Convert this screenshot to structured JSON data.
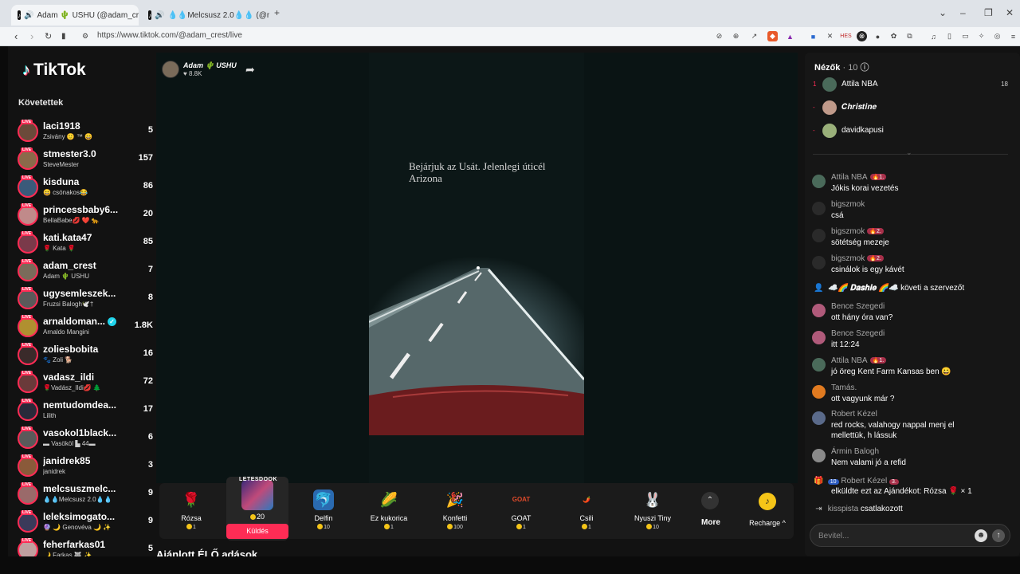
{
  "browser": {
    "tabs": [
      {
        "title": "Adam 🌵 USHU (@adam_crest",
        "active": true
      },
      {
        "title": "💧💧Melcsusz 2.0💧💧 (@melcsu",
        "active": false
      }
    ],
    "new_tab": "+",
    "url": "https://www.tiktok.com/@adam_crest/live"
  },
  "sidebar": {
    "logo": "TikTok",
    "following_title": "Követettek",
    "live_tag": "LIVE",
    "items": [
      {
        "name": "laci1918",
        "sub": "Zsivány 🙂 ™ 😄",
        "count": "5",
        "color": "#6b4a3a"
      },
      {
        "name": "stmester3.0",
        "sub": "SteveMester",
        "count": "157",
        "color": "#8a6a4a"
      },
      {
        "name": "kisduna",
        "sub": "😄 csónakos😂",
        "count": "86",
        "color": "#3a5a7a"
      },
      {
        "name": "princessbaby6...",
        "sub": "BellaBabe💋 ❤️ 🐆",
        "count": "20",
        "color": "#c08a8a"
      },
      {
        "name": "kati.kata47",
        "sub": "🌹 Kata 🌹",
        "count": "85",
        "color": "#7a3a4a"
      },
      {
        "name": "adam_crest",
        "sub": "Adam 🌵 USHU",
        "count": "7",
        "color": "#7a6b5a"
      },
      {
        "name": "ugysemleszek...",
        "sub": "Fruzsi Balogh🕊️†",
        "count": "8",
        "color": "#5a5a5a"
      },
      {
        "name": "arnaldoman...",
        "sub": "Arnaldo Mangini",
        "count": "1.8K",
        "color": "#b09030",
        "verified": true
      },
      {
        "name": "zoliesbobita",
        "sub": "🐾 Zoli 🐕",
        "count": "16",
        "color": "#3a2a2a"
      },
      {
        "name": "vadasz_ildi",
        "sub": "🌹Vadász_Ildi💋 🌲",
        "count": "72",
        "color": "#6a3a3a"
      },
      {
        "name": "nemtudomdea...",
        "sub": "Lilith",
        "count": "17",
        "color": "#2a2a3a"
      },
      {
        "name": "vasokol1black...",
        "sub": "▬ Vasököl ▙ 44▬",
        "count": "6",
        "color": "#5a5a5a"
      },
      {
        "name": "janidrek85",
        "sub": "janidrek",
        "count": "3",
        "color": "#8a5a3a"
      },
      {
        "name": "melcsuszmelc...",
        "sub": "💧💧Melcsusz 2.0💧💧",
        "count": "9",
        "color": "#9a6a6a"
      },
      {
        "name": "leleksimogato...",
        "sub": "🔮 🌙 Genovéva 🌙 ✨",
        "count": "9",
        "color": "#3a3a5a"
      },
      {
        "name": "feherfarkas01",
        "sub": "🌙 Farkas 🐺 ✨",
        "count": "5",
        "color": "#c0a0a0"
      }
    ]
  },
  "host": {
    "name": "Adam 🌵 USHU",
    "likes": "♥ 8.8K"
  },
  "video": {
    "caption_line1": "Bejárjuk az Usát. Jelenlegi úticél",
    "caption_line2": "Arizona"
  },
  "gifts": [
    {
      "name": "Rózsa",
      "price": "1",
      "icon": "🌹",
      "bg": "transparent"
    },
    {
      "name": "Delfin",
      "price": "10",
      "icon": "🐬",
      "bg": "#2a6ab0"
    },
    {
      "name": "Ez kukorica",
      "price": "1",
      "icon": "🌽",
      "bg": "transparent"
    },
    {
      "name": "Konfetti",
      "price": "100",
      "icon": "🎉",
      "bg": "transparent"
    },
    {
      "name": "GOAT",
      "price": "1",
      "icon": "GOAT",
      "bg": "transparent"
    },
    {
      "name": "Csili",
      "price": "1",
      "icon": "🌶️",
      "bg": "transparent"
    },
    {
      "name": "Nyuszi Tiny",
      "price": "10",
      "icon": "🐰",
      "bg": "transparent"
    }
  ],
  "featured_gift": {
    "tag": "LETESDOOK",
    "price": "20",
    "send_label": "Küldés"
  },
  "more_label": "More",
  "recharge_label": "Recharge ^",
  "recommended_label": "Ajánlott ÉLŐ adások",
  "viewers": {
    "title": "Nézők",
    "count": "· 10",
    "list": [
      {
        "rank": "1",
        "name": "Attila NBA",
        "score": "18",
        "color": "#4a6a5a"
      },
      {
        "rank": "-",
        "name": "𝑪𝒉𝒓𝒊𝒔𝒕𝒊𝒏𝒆",
        "score": "",
        "color": "#c09a8a"
      },
      {
        "rank": "-",
        "name": "davidkapusi",
        "score": "",
        "color": "#9ab07a"
      }
    ]
  },
  "chat": [
    {
      "user": "Attila NBA",
      "badge": "1.",
      "text": "Jókis korai vezetés",
      "color": "#4a6a5a"
    },
    {
      "user": "bigszmok",
      "badge": "",
      "text": "csá",
      "color": "#2a2a2a"
    },
    {
      "user": "bigszmok",
      "badge": "2.",
      "text": "sötétség mezeje",
      "color": "#2a2a2a"
    },
    {
      "user": "bigszmok",
      "badge": "2.",
      "text": "csinálok is egy kávét",
      "color": "#2a2a2a"
    },
    {
      "user": "Bence Szegedi",
      "badge": "",
      "text": "ott hány óra van?",
      "color": "#b05a7a"
    },
    {
      "user": "Bence Szegedi",
      "badge": "",
      "text": "itt 12:24",
      "color": "#b05a7a"
    },
    {
      "user": "Attila NBA",
      "badge": "1.",
      "text": "jó öreg Kent Farm Kansas ben 😀",
      "color": "#4a6a5a"
    },
    {
      "user": "Tamás.",
      "badge": "",
      "text": "ott vagyunk már ?",
      "color": "#e07a20"
    },
    {
      "user": "Robert Kézel",
      "badge": "",
      "text": "red rocks, valahogy nappal menj el mellettük, h lássuk",
      "color": "#5a6a8a"
    },
    {
      "user": "Ármin Balogh",
      "badge": "",
      "text": "Nem valami jó a refid",
      "color": "#8a8a8a"
    }
  ],
  "system_msgs": {
    "follow_name": "☁️🌈 𝐃𝐚𝐬𝐡𝐢𝐞 🌈☁️",
    "follow_text": "követi a szervezőt",
    "gift_level": "10",
    "gift_user": "Robert Kézel",
    "gift_badge": "3.",
    "gift_text": "elküldte ezt az Ajándékot: Rózsa 🌹 × 1",
    "join_user": "kisspista",
    "join_text": "csatlakozott"
  },
  "chat_input": {
    "placeholder": "Bevitel..."
  }
}
